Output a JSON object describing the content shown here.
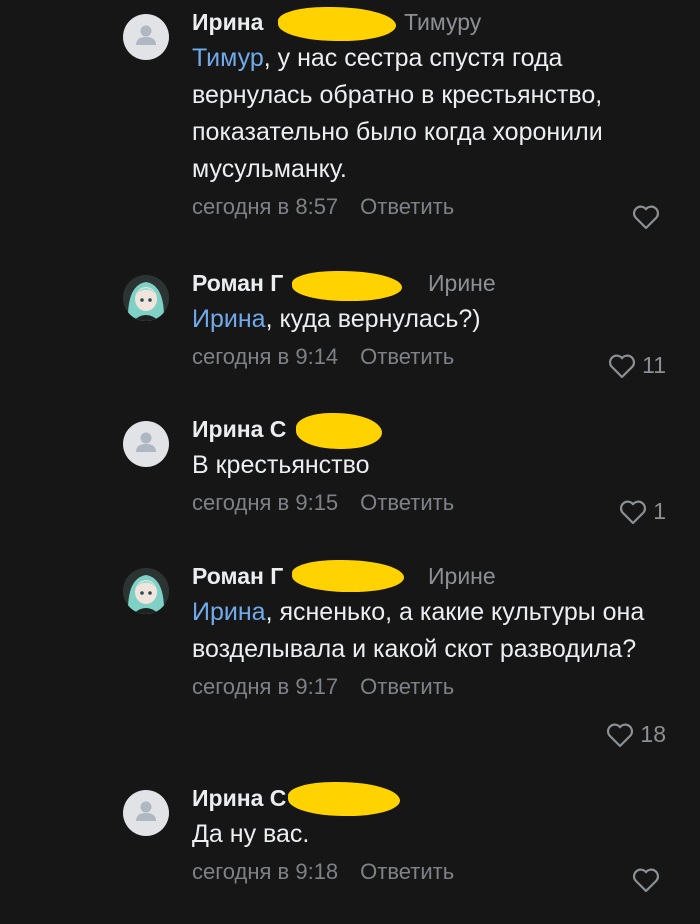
{
  "comments": [
    {
      "author": "Ирина",
      "reply_to": "Тимуру",
      "mention": "Тимур",
      "text": ", у нас сестра спустя года вернулась обратно в крестьянство, показательно было когда хоронили мусульманку.",
      "time": "сегодня в 8:57",
      "reply_label": "Ответить",
      "likes": "",
      "avatar": "default-avatar"
    },
    {
      "author": "Роман Г",
      "reply_to": "Ирине",
      "mention": "Ирина",
      "text": ", куда вернулась?)",
      "time": "сегодня в 9:14",
      "reply_label": "Ответить",
      "likes": "11",
      "avatar": "anime-avatar"
    },
    {
      "author": "Ирина С",
      "reply_to": "",
      "mention": "",
      "text": "В крестьянство",
      "time": "сегодня в 9:15",
      "reply_label": "Ответить",
      "likes": "1",
      "avatar": "default-avatar"
    },
    {
      "author": "Роман Г",
      "reply_to": "Ирине",
      "mention": "Ирина",
      "text": ", ясненько, а какие культуры она возделывала и какой скот разводила?",
      "time": "сегодня в 9:17",
      "reply_label": "Ответить",
      "likes": "18",
      "avatar": "anime-avatar"
    },
    {
      "author": "Ирина С",
      "reply_to": "",
      "mention": "",
      "text": "Да ну вас.",
      "time": "сегодня в 9:18",
      "reply_label": "Ответить",
      "likes": "",
      "avatar": "default-avatar"
    }
  ],
  "colors": {
    "background": "#161616",
    "mention": "#71aaeb",
    "muted": "#7e8186",
    "redaction": "#ffd200"
  }
}
